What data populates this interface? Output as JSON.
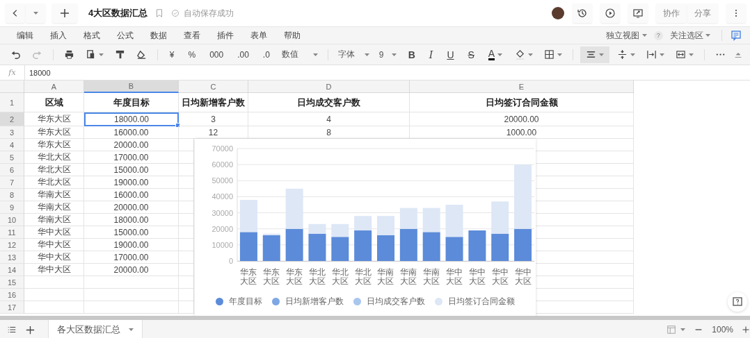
{
  "top_bar": {
    "title": "4大区数据汇总",
    "save_status": "自动保存成功",
    "buttons": [
      "协作",
      "分享"
    ]
  },
  "menu": {
    "items": [
      "编辑",
      "插入",
      "格式",
      "公式",
      "数据",
      "查看",
      "插件",
      "表单",
      "帮助"
    ],
    "view_mode": "独立视图",
    "help": "?",
    "follow": "关注选区"
  },
  "toolbar": {
    "number_buttons": [
      "¥",
      "%",
      "000",
      ".00",
      ".0"
    ],
    "number_format": "数值",
    "font": "字体",
    "font_size": "9",
    "style_buttons": [
      "B",
      "I",
      "U",
      "S",
      "A"
    ]
  },
  "formula_bar": {
    "label": "fx",
    "value": "18000"
  },
  "sheet": {
    "columns": [
      {
        "label": "A",
        "selected": false
      },
      {
        "label": "B",
        "selected": true
      },
      {
        "label": "C",
        "selected": false
      },
      {
        "label": "D",
        "selected": false
      },
      {
        "label": "E",
        "selected": false
      }
    ],
    "rows": [
      {
        "label": "1",
        "selected": false,
        "cells": [
          "区域",
          "年度目标",
          "日均新增客户数",
          "日均成交客户数",
          "日均签订合同金额"
        ]
      },
      {
        "label": "2",
        "selected": true,
        "cells": [
          "华东大区",
          "18000.00",
          "3",
          "4",
          "20000.00"
        ]
      },
      {
        "label": "3",
        "selected": false,
        "cells": [
          "华东大区",
          "16000.00",
          "12",
          "8",
          "1000.00"
        ]
      },
      {
        "label": "4",
        "selected": false,
        "cells": [
          "华东大区",
          "20000.00"
        ]
      },
      {
        "label": "5",
        "selected": false,
        "cells": [
          "华北大区",
          "17000.00"
        ]
      },
      {
        "label": "6",
        "selected": false,
        "cells": [
          "华北大区",
          "15000.00"
        ]
      },
      {
        "label": "7",
        "selected": false,
        "cells": [
          "华北大区",
          "19000.00"
        ]
      },
      {
        "label": "8",
        "selected": false,
        "cells": [
          "华南大区",
          "16000.00"
        ]
      },
      {
        "label": "9",
        "selected": false,
        "cells": [
          "华南大区",
          "20000.00"
        ]
      },
      {
        "label": "10",
        "selected": false,
        "cells": [
          "华南大区",
          "18000.00"
        ]
      },
      {
        "label": "11",
        "selected": false,
        "cells": [
          "华中大区",
          "15000.00"
        ]
      },
      {
        "label": "12",
        "selected": false,
        "cells": [
          "华中大区",
          "19000.00"
        ]
      },
      {
        "label": "13",
        "selected": false,
        "cells": [
          "华中大区",
          "17000.00"
        ]
      },
      {
        "label": "14",
        "selected": false,
        "cells": [
          "华中大区",
          "20000.00"
        ]
      },
      {
        "label": "15",
        "selected": false
      },
      {
        "label": "16",
        "selected": false
      },
      {
        "label": "17",
        "selected": false
      }
    ],
    "chart_data": {
      "type": "bar",
      "stacked": true,
      "categories": [
        "华东大区",
        "华东大区",
        "华东大区",
        "华北大区",
        "华北大区",
        "华北大区",
        "华南大区",
        "华南大区",
        "华南大区",
        "华中大区",
        "华中大区",
        "华中大区",
        "华中大区"
      ],
      "series": [
        {
          "name": "年度目标",
          "color": "#5b8bd9",
          "values": [
            18000,
            16000,
            20000,
            17000,
            15000,
            19000,
            16000,
            20000,
            18000,
            15000,
            19000,
            17000,
            20000
          ]
        },
        {
          "name": "日均新增客户数",
          "color": "#7ea7e3",
          "values": [
            0,
            0,
            null,
            null,
            null,
            null,
            null,
            null,
            null,
            null,
            null,
            null,
            null
          ]
        },
        {
          "name": "日均成交客户数",
          "color": "#a9c6ee",
          "values": [
            0,
            0,
            null,
            null,
            null,
            null,
            null,
            null,
            null,
            null,
            null,
            null,
            null
          ]
        },
        {
          "name": "日均签订合同金额",
          "color": "#dde7f6",
          "values": [
            20000,
            1000,
            25000,
            6000,
            8000,
            9000,
            12000,
            13000,
            15000,
            20000,
            0,
            20000,
            40000
          ]
        }
      ],
      "grid": true,
      "legend": true,
      "ylim": [
        0,
        70000
      ],
      "yticks": [
        0,
        10000,
        20000,
        30000,
        40000,
        50000,
        60000,
        70000
      ]
    }
  },
  "sheet_tabs": [
    {
      "label": "各大区数据汇总",
      "selected": true
    }
  ],
  "zoom": "100%"
}
